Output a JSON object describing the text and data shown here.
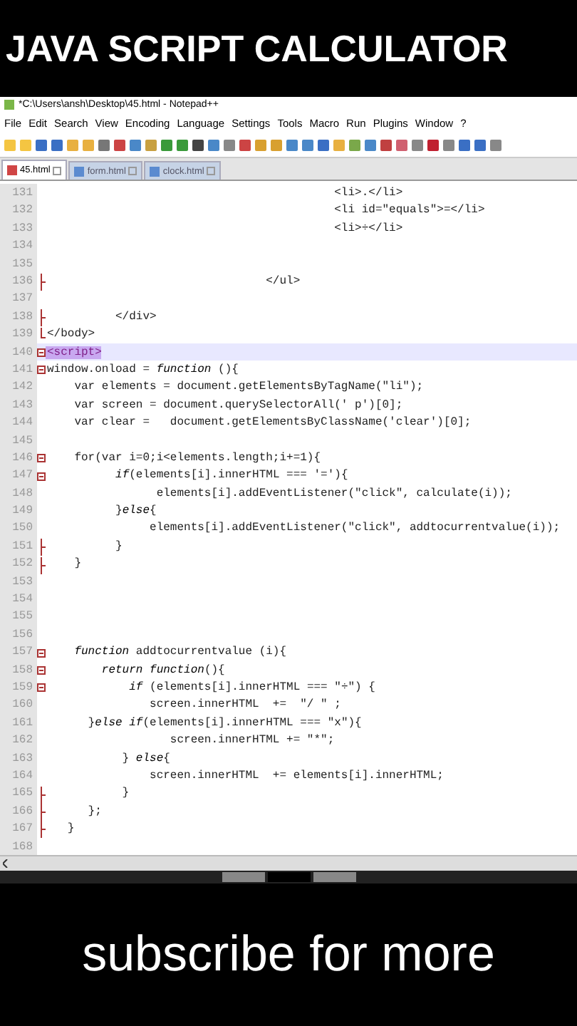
{
  "caption_top": "JAVA SCRIPT CALCULATOR",
  "window": {
    "title": "*C:\\Users\\ansh\\Desktop\\45.html - Notepad++"
  },
  "menu": [
    "File",
    "Edit",
    "Search",
    "View",
    "Encoding",
    "Language",
    "Settings",
    "Tools",
    "Macro",
    "Run",
    "Plugins",
    "Window",
    "?"
  ],
  "tabs": [
    {
      "label": "45.html",
      "selected": true
    },
    {
      "label": "form.html",
      "selected": false
    },
    {
      "label": "clock.html",
      "selected": false
    }
  ],
  "lines": [
    {
      "number": "131",
      "kind": "plain",
      "text": "                                          <li>.</li>"
    },
    {
      "number": "132",
      "kind": "plain",
      "text": "                                          <li id=\"equals\">=</li>"
    },
    {
      "number": "133",
      "kind": "plain",
      "text": "                                          <li>÷</li>"
    },
    {
      "number": "134",
      "kind": "plain"
    },
    {
      "number": "135",
      "kind": "plain"
    },
    {
      "number": "136",
      "kind": "end",
      "text": "                                </ul>"
    },
    {
      "number": "137",
      "kind": "plain"
    },
    {
      "number": "138",
      "kind": "end",
      "text": "          </div>"
    },
    {
      "number": "139",
      "kind": "last",
      "text": "</body>"
    },
    {
      "number": "140",
      "kind": "open",
      "text": "<script>",
      "selected": true
    },
    {
      "number": "141",
      "kind": "open",
      "text": "window.onload = *function* (){"
    },
    {
      "number": "142",
      "kind": "plain",
      "text": "    var elements = document.getElementsByTagName(\"li\");"
    },
    {
      "number": "143",
      "kind": "plain",
      "text": "    var screen = document.querySelectorAll(' p')[0];"
    },
    {
      "number": "144",
      "kind": "plain",
      "text": "    var clear =   document.getElementsByClassName('clear')[0];"
    },
    {
      "number": "145",
      "kind": "plain"
    },
    {
      "number": "146",
      "kind": "open",
      "text": "    for(var i=0;i<elements.length;i+=1){"
    },
    {
      "number": "147",
      "kind": "open",
      "text": "          *if*(elements[i].innerHTML === '='){"
    },
    {
      "number": "148",
      "kind": "plain",
      "text": "                elements[i].addEventListener(\"click\", calculate(i));"
    },
    {
      "number": "149",
      "kind": "plain",
      "text": "          }*else*{"
    },
    {
      "number": "150",
      "kind": "plain",
      "text": "               elements[i].addEventListener(\"click\", addtocurrentvalue(i));"
    },
    {
      "number": "151",
      "kind": "end",
      "text": "          }"
    },
    {
      "number": "152",
      "kind": "end",
      "text": "    }"
    },
    {
      "number": "153",
      "kind": "plain"
    },
    {
      "number": "154",
      "kind": "plain"
    },
    {
      "number": "155",
      "kind": "plain"
    },
    {
      "number": "156",
      "kind": "plain"
    },
    {
      "number": "157",
      "kind": "open",
      "text": "    *function* addtocurrentvalue (i){"
    },
    {
      "number": "158",
      "kind": "open",
      "text": "        *return* *function*(){"
    },
    {
      "number": "159",
      "kind": "open",
      "text": "            *if* (elements[i].innerHTML === \"÷\") {"
    },
    {
      "number": "160",
      "kind": "plain",
      "text": "               screen.innerHTML  +=  \"/ \" ;"
    },
    {
      "number": "161",
      "kind": "plain",
      "text": "      }*else* *if*(elements[i].innerHTML === \"x\"){"
    },
    {
      "number": "162",
      "kind": "plain",
      "text": "                  screen.innerHTML += \"*\";"
    },
    {
      "number": "163",
      "kind": "plain",
      "text": "           } *else*{"
    },
    {
      "number": "164",
      "kind": "plain",
      "text": "               screen.innerHTML  += elements[i].innerHTML;"
    },
    {
      "number": "165",
      "kind": "end",
      "text": "           }"
    },
    {
      "number": "166",
      "kind": "end",
      "text": "      };"
    },
    {
      "number": "167",
      "kind": "end",
      "text": "   }"
    },
    {
      "number": "168",
      "kind": "plain"
    }
  ],
  "caption_bottom": "subscribe for more"
}
